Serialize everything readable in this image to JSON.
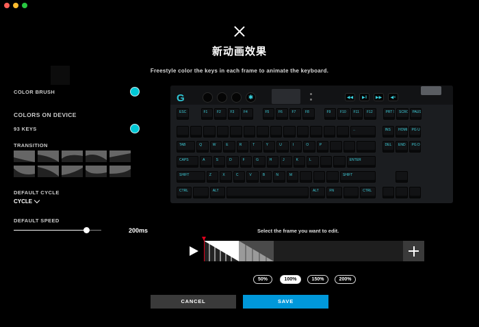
{
  "dialog": {
    "title": "新动画效果",
    "subtitle": "Freestyle color the keys in each frame to animate the keyboard."
  },
  "left_panel": {
    "color_brush_label": "COLOR BRUSH",
    "colors_on_device_label": "COLORS ON DEVICE",
    "keys_count_label": "93 KEYS",
    "transition_label": "TRANSITION",
    "default_cycle_label": "DEFAULT CYCLE",
    "cycle_value": "CYCLE",
    "default_speed_label": "DEFAULT SPEED",
    "speed_value": "200ms",
    "speed_level": 0.83,
    "brush_color": "#00c8d6"
  },
  "timeline": {
    "hint": "Select the frame you want to edit.",
    "frames": 2,
    "zoom_options": [
      "50%",
      "100%",
      "150%",
      "200%"
    ],
    "zoom_selected": "100%"
  },
  "footer": {
    "cancel_label": "CANCEL",
    "save_label": "SAVE"
  },
  "colors": {
    "accent": "#00c8d6",
    "save": "#0098da",
    "playhead": "#e0001c"
  },
  "keyboard": {
    "legends": {
      "esc": "ESC",
      "f1": "F1",
      "f2": "F2",
      "f3": "F3",
      "f4": "F4",
      "f5": "F5",
      "f6": "F6",
      "f7": "F7",
      "f8": "F8",
      "f9": "F9",
      "f10": "F10",
      "f11": "F11",
      "f12": "F12",
      "prt": "PRT SC",
      "scr": "SCROLL",
      "pause": "PAUSE",
      "q": "Q",
      "w": "W",
      "e": "E",
      "r": "R",
      "t": "T",
      "y": "Y",
      "u": "U",
      "i": "I",
      "o": "O",
      "p": "P",
      "a": "A",
      "s": "S",
      "d": "D",
      "f": "F",
      "g": "G",
      "h": "H",
      "j": "J",
      "k": "K",
      "l": "L",
      "z": "Z",
      "x": "X",
      "c": "C",
      "v": "V",
      "b": "B",
      "n": "N",
      "m": "M",
      "tab": "TAB",
      "caps": "CAPS",
      "shift": "SHIFT",
      "rshift": "SHIFT",
      "enter": "ENTER",
      "ctrl": "CTRL",
      "rctrl": "CTRL",
      "alt": "ALT",
      "altgr": "ALT",
      "fn": "FN",
      "ins": "INS",
      "home": "HOME",
      "pgup": "PG UP",
      "del": "DEL",
      "end": "END",
      "pgdn": "PG DN",
      "backspace": "←"
    }
  }
}
